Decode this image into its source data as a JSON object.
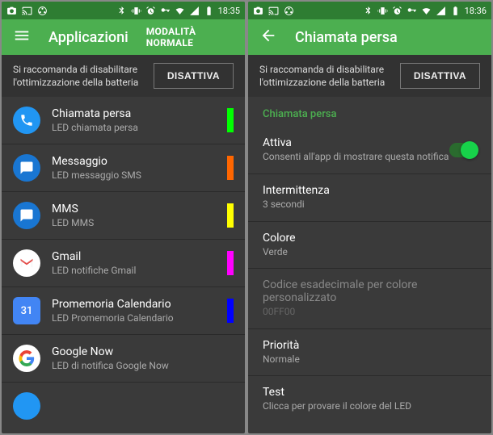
{
  "left": {
    "statusbar": {
      "time": "18:35"
    },
    "appbar": {
      "title": "Applicazioni",
      "mode": "MODALITÀ NORMALE"
    },
    "banner": {
      "msg": "Si raccomanda di disabilitare l'ottimizzazione della batteria",
      "btn": "DISATTIVA"
    },
    "apps": [
      {
        "title": "Chiamata persa",
        "sub": "LED chiamata persa",
        "color": "#00ff00",
        "icon": "phone"
      },
      {
        "title": "Messaggio",
        "sub": "LED messaggio SMS",
        "color": "#ff6600",
        "icon": "msg"
      },
      {
        "title": "MMS",
        "sub": "LED MMS",
        "color": "#ffff00",
        "icon": "msg"
      },
      {
        "title": "Gmail",
        "sub": "LED notifiche Gmail",
        "color": "#ff00ff",
        "icon": "gmail"
      },
      {
        "title": "Promemoria Calendario",
        "sub": "LED Promemoria Calendario",
        "color": "#0000ff",
        "icon": "cal"
      },
      {
        "title": "Google Now",
        "sub": "LED di notifica Google Now",
        "color": "",
        "icon": "gnow"
      }
    ]
  },
  "right": {
    "statusbar": {
      "time": "18:36"
    },
    "appbar": {
      "title": "Chiamata persa"
    },
    "banner": {
      "msg": "Si raccomanda di disabilitare l'ottimizzazione della batteria",
      "btn": "DISATTIVA"
    },
    "section": "Chiamata persa",
    "settings": {
      "attiva": {
        "title": "Attiva",
        "sub": "Consenti all'app di mostrare questa notifica"
      },
      "intermittenza": {
        "title": "Intermittenza",
        "sub": "3 secondi"
      },
      "colore": {
        "title": "Colore",
        "sub": "Verde"
      },
      "hex": {
        "title": "Codice esadecimale per colore personalizzato",
        "sub": "00FF00"
      },
      "priorita": {
        "title": "Priorità",
        "sub": "Normale"
      },
      "test": {
        "title": "Test",
        "sub": "Clicca per provare il colore del LED"
      }
    }
  }
}
